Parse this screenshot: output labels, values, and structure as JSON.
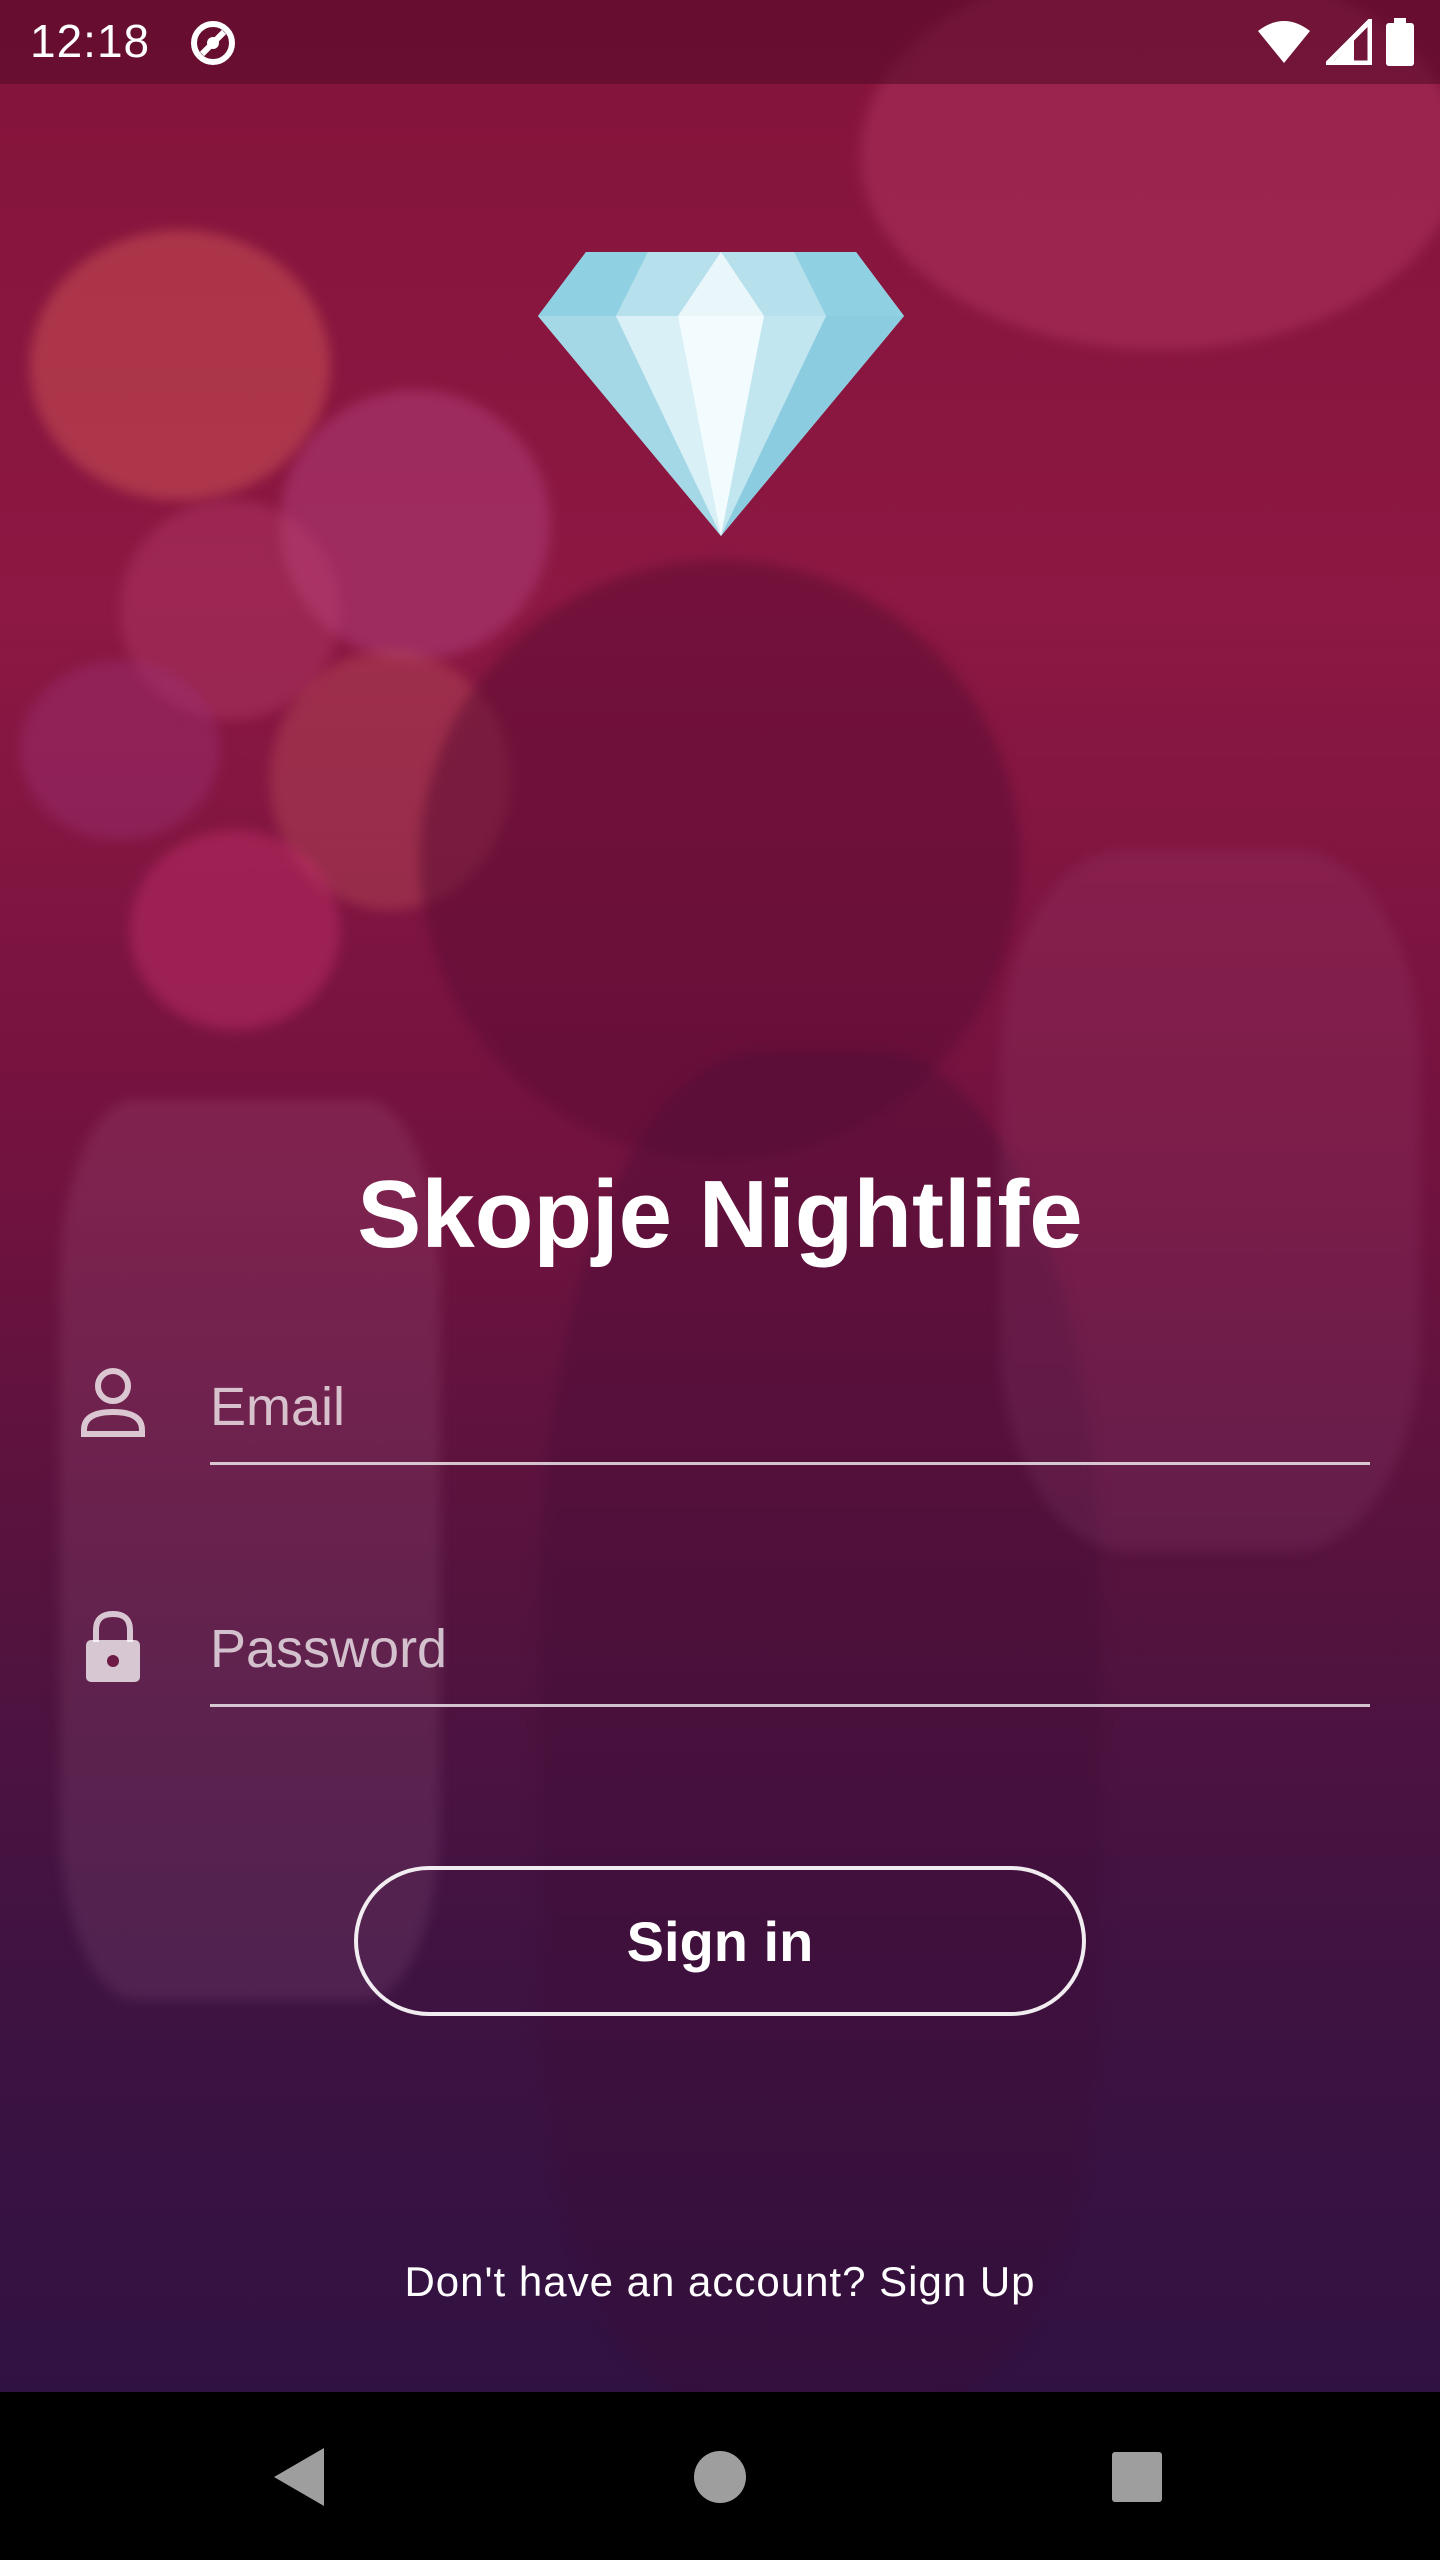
{
  "status_bar": {
    "time": "12:18",
    "app_icon": "no-disturb-icon",
    "wifi_icon": "wifi-icon",
    "signal_icon": "cell-signal-icon",
    "battery_icon": "battery-icon"
  },
  "app": {
    "logo_icon": "diamond-icon",
    "title": "Skopje Nightlife"
  },
  "form": {
    "email": {
      "icon": "person-icon",
      "placeholder": "Email",
      "value": ""
    },
    "password": {
      "icon": "lock-icon",
      "placeholder": "Password",
      "value": ""
    },
    "sign_in_label": "Sign in",
    "signup_prompt": "Don't have an account? Sign Up"
  },
  "nav_bar": {
    "back_icon": "back-triangle-icon",
    "home_icon": "home-circle-icon",
    "recent_icon": "recent-square-icon"
  },
  "colors": {
    "background_top": "#8a1a3f",
    "background_bottom": "#2a103a",
    "text": "#ffffff",
    "nav_bar": "#000000"
  }
}
